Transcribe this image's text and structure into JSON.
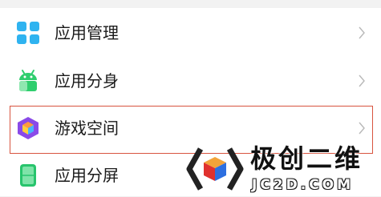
{
  "settings": {
    "items": [
      {
        "label": "应用管理",
        "icon": "app-management-icon",
        "color": "#2fb3f0"
      },
      {
        "label": "应用分身",
        "icon": "app-clone-icon",
        "color": "#2fce6e"
      },
      {
        "label": "游戏空间",
        "icon": "game-space-icon",
        "color": "#8a4ae8",
        "highlighted": true
      },
      {
        "label": "应用分屏",
        "icon": "split-screen-icon",
        "color": "#27c46c"
      }
    ]
  },
  "watermark": {
    "brand": "极创二维",
    "url": "JC2D.COM",
    "icon": "cube-logo-icon",
    "highlight_color": "#d8543f"
  }
}
